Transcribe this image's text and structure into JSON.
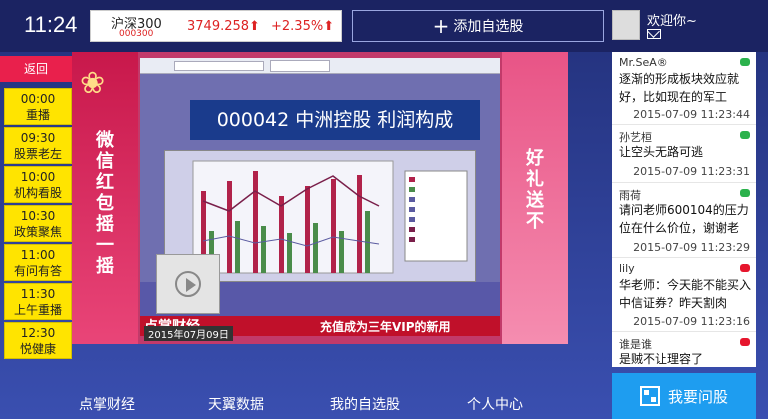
{
  "header": {
    "time": "11:24",
    "index_name": "沪深300",
    "index_code": "000300",
    "index_price": "3749.258",
    "index_change": "+2.35%",
    "add_favorite_label": "添加自选股",
    "welcome": "欢迎你~",
    "up_color": "#dd2222"
  },
  "left": {
    "back_label": "返回",
    "schedule": [
      {
        "time": "00:00",
        "title": "重播"
      },
      {
        "time": "09:30",
        "title": "股票老左"
      },
      {
        "time": "10:00",
        "title": "机构看股"
      },
      {
        "time": "10:30",
        "title": "政策聚焦"
      },
      {
        "time": "11:00",
        "title": "有问有答"
      },
      {
        "time": "11:30",
        "title": "上午重播"
      },
      {
        "time": "12:30",
        "title": "悦健康"
      }
    ]
  },
  "video": {
    "banner_left": "微信红包摇一摇",
    "banner_right": "好礼送不",
    "slide_title": "000042 中洲控股 利润构成",
    "logo": "点掌财经",
    "date": "2015年07月09日",
    "scroll_text": "充值成为三年VIP的新用"
  },
  "chat": {
    "messages": [
      {
        "user": "Mr.SeA®",
        "text": "逐渐的形成板块效应就好，比如现在的军工",
        "time": "2015-07-09 11:23:44",
        "icon": "wechat-icon",
        "icon_color": "#2bb24c"
      },
      {
        "user": "孙艺桓",
        "text": "让空头无路可逃",
        "time": "2015-07-09 11:23:31",
        "icon": "wechat-icon",
        "icon_color": "#2bb24c"
      },
      {
        "user": "雨荷",
        "text": "请问老师600104的压力位在什么价位，谢谢老",
        "time": "2015-07-09 11:23:29",
        "icon": "wechat-icon",
        "icon_color": "#2bb24c"
      },
      {
        "user": "lily",
        "text": "华老师：今天能不能买入中信证券？昨天割肉",
        "time": "2015-07-09 11:23:16",
        "icon": "weibo-icon",
        "icon_color": "#e6162d"
      },
      {
        "user": "谁是谁",
        "text": "是贼不让理容了",
        "time": "",
        "icon": "weibo-icon",
        "icon_color": "#e6162d"
      }
    ]
  },
  "bottom_nav": {
    "items": [
      "点掌财经",
      "天翼数据",
      "我的自选股",
      "个人中心"
    ],
    "ask_label": "我要问股",
    "ask_color": "#1e9df0"
  }
}
